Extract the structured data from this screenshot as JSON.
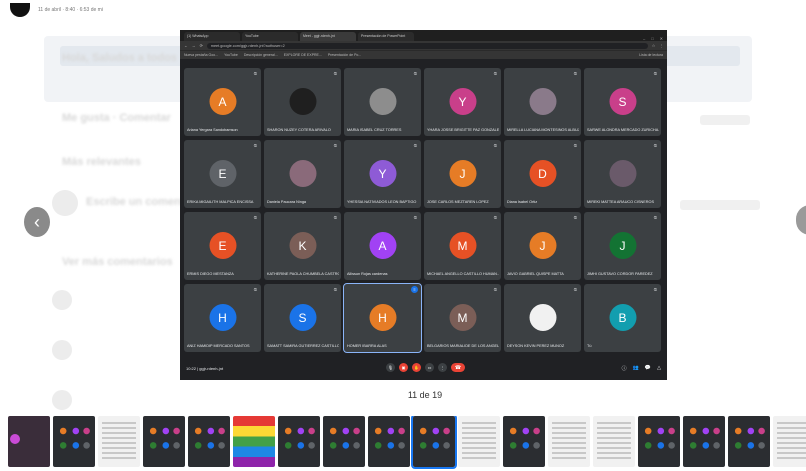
{
  "background": {
    "post_meta": "11 de abril · 8:40 · 6:53 de mi",
    "blur_texts": [
      "Hola, Saludos a todos",
      "Me gusta · Comentar",
      "Más relevantes",
      "Escribe un comentario...",
      "Ver más comentarios"
    ]
  },
  "browser": {
    "tabs": [
      "(1) WhatsApp",
      "YouTube",
      "Meet - ggjr-rdenh-jnt",
      "Presentación de PowerPoint"
    ],
    "url": "meet.google.com/ggjr-rdenh-jnt?authuser=2",
    "bookmarks": [
      "Nueva pestaña Goo...",
      "YouTube",
      "Descripción general...",
      "EXPLORE DE EXPRE...",
      "Presentación de Po..."
    ],
    "reading_list": "Lista de lectura"
  },
  "participants": [
    {
      "initial": "A",
      "color": "#e67c26",
      "name": "Ariana Yergara Sandobamson",
      "type": "initial"
    },
    {
      "initial": "",
      "color": "#1f1f1f",
      "name": "SHARON NUZEY COTERA ARIVALO",
      "type": "photo"
    },
    {
      "initial": "",
      "color": "#8d8d8d",
      "name": "MARIA ISABEL CRUZ TORRES",
      "type": "photo"
    },
    {
      "initial": "Y",
      "color": "#c93f8a",
      "name": "YHARA JOSSE BRIGITTE PAZ GONZALES",
      "type": "initial"
    },
    {
      "initial": "",
      "color": "#8a7a8a",
      "name": "MIRELLA LUCIANA MONTESINOS ALBUJE...",
      "type": "photo"
    },
    {
      "initial": "S",
      "color": "#c93f8a",
      "name": "SARWE ALONDRA MERCADO ZURICHA...",
      "type": "initial"
    },
    {
      "initial": "E",
      "color": "#5f6368",
      "name": "ERIKA MIGAILITH MALPICA ENCISSA",
      "type": "initial"
    },
    {
      "initial": "",
      "color": "#8a6a7a",
      "name": "Daniela Paucara Ninga",
      "type": "photo"
    },
    {
      "initial": "Y",
      "color": "#8e5bd6",
      "name": "YHESSIA NATIVIADOS LEON BAPTIGO",
      "type": "initial"
    },
    {
      "initial": "J",
      "color": "#e67c26",
      "name": "JOSE CARLOS MEZTAREN LOPEZ",
      "type": "initial"
    },
    {
      "initial": "D",
      "color": "#e65125",
      "name": "Diana Isabel Ortiz",
      "type": "initial"
    },
    {
      "initial": "",
      "color": "#6a5a6a",
      "name": "MIREKI MATTEA ARAUCO CISNEROS",
      "type": "photo"
    },
    {
      "initial": "E",
      "color": "#e65125",
      "name": "ERMIS DIEGO MESTANZA",
      "type": "initial"
    },
    {
      "initial": "K",
      "color": "#7b5e57",
      "name": "KATHERINE PAOLA CHUMBELA CASTRO",
      "type": "initial"
    },
    {
      "initial": "A",
      "color": "#a142f4",
      "name": "Allissun Rojas cardenas",
      "type": "initial"
    },
    {
      "initial": "M",
      "color": "#e65125",
      "name": "MICHAEL ANGELLO CASTILLO HUMAN...",
      "type": "initial"
    },
    {
      "initial": "J",
      "color": "#e67c26",
      "name": "JAVIO GABRIEL QUISPE MATTA",
      "type": "initial"
    },
    {
      "initial": "J",
      "color": "#137333",
      "name": "JIMHI GUSTAVO CORDOR PAREDEZ",
      "type": "initial"
    },
    {
      "initial": "H",
      "color": "#1a73e8",
      "name": "ANIZ HAMIDIP MERCADO SANTOS",
      "type": "initial"
    },
    {
      "initial": "S",
      "color": "#1a73e8",
      "name": "SAMATT SAMIRA GUTIERREZ CASTILLO",
      "type": "initial"
    },
    {
      "initial": "H",
      "color": "#e67c26",
      "name": "HOMER IBARRA ALAS",
      "type": "initial",
      "speaking": true
    },
    {
      "initial": "M",
      "color": "#7b5e57",
      "name": "BELGARIOS MARIALIDE DE LOS ANGEL...",
      "type": "initial"
    },
    {
      "initial": "",
      "color": "#f1f1f1",
      "name": "DEYSON KEVIN PEREZ MUNOZ",
      "type": "photo"
    },
    {
      "initial": "B",
      "color": "#129eaf",
      "name": "Tú",
      "type": "initial"
    }
  ],
  "meet": {
    "time_code": "10:22 | ggjr-rdenh-jnt"
  },
  "viewer": {
    "counter": "11 de 19",
    "prev_icon": "chevron-left-icon",
    "next_icon": "chevron-right-icon"
  },
  "thumbnails": [
    "first",
    "dark",
    "doc",
    "dark",
    "dark",
    "color",
    "dark",
    "dark",
    "dark",
    "dark",
    "doc",
    "dark",
    "doc",
    "doc",
    "dark",
    "dark",
    "dark",
    "doc"
  ]
}
